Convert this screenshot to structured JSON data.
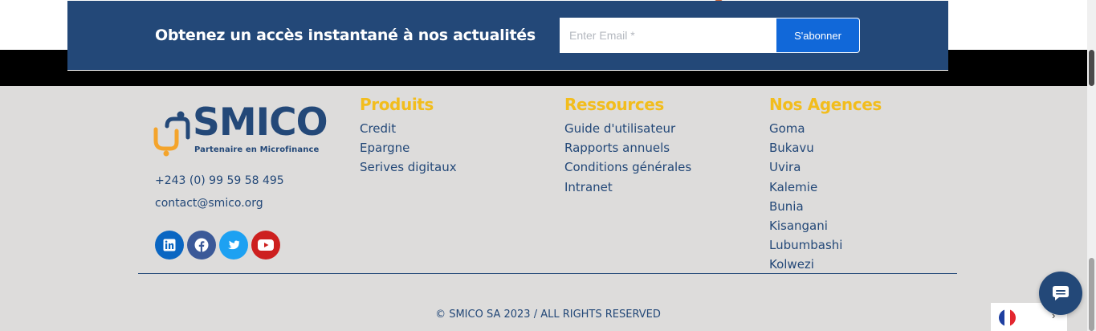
{
  "newsletter": {
    "title": "Obtenez un accès instantané à nos actualités",
    "email_placeholder": "Enter Email *",
    "subscribe_label": "S'abonner"
  },
  "brand": {
    "name": "SMICO",
    "tagline": "Partenaire en Microfinance",
    "colors": {
      "navy": "#234878",
      "gold": "#f2bd1d",
      "blue": "#1168d9"
    }
  },
  "contact": {
    "phone": "+243 (0) 99 59 58 495",
    "email": "contact@smico.org"
  },
  "socials": [
    {
      "name": "linkedin",
      "icon": "linkedin-icon",
      "color": "#0a66c2"
    },
    {
      "name": "facebook",
      "icon": "facebook-icon",
      "color": "#3b5998"
    },
    {
      "name": "twitter",
      "icon": "twitter-icon",
      "color": "#1da1f2"
    },
    {
      "name": "youtube",
      "icon": "youtube-icon",
      "color": "#cd201f"
    }
  ],
  "footer": {
    "produits": {
      "title": "Produits",
      "items": [
        "Credit",
        "Epargne",
        "Serives digitaux"
      ]
    },
    "ressources": {
      "title": "Ressources",
      "items": [
        "Guide d'utilisateur",
        "Rapports annuels",
        "Conditions générales",
        "Intranet"
      ]
    },
    "agences": {
      "title": "Nos Agences",
      "items": [
        "Goma",
        "Bukavu",
        "Uvira",
        "Kalemie",
        "Bunia",
        "Kisangani",
        "Lubumbashi",
        "Kolwezi"
      ]
    }
  },
  "copyright": "© SMICO SA 2023 / ALL RIGHTS RESERVED",
  "language": {
    "icon": "france-flag-icon",
    "chevron": "›"
  },
  "chat": {
    "icon": "chat-bubble-icon"
  }
}
